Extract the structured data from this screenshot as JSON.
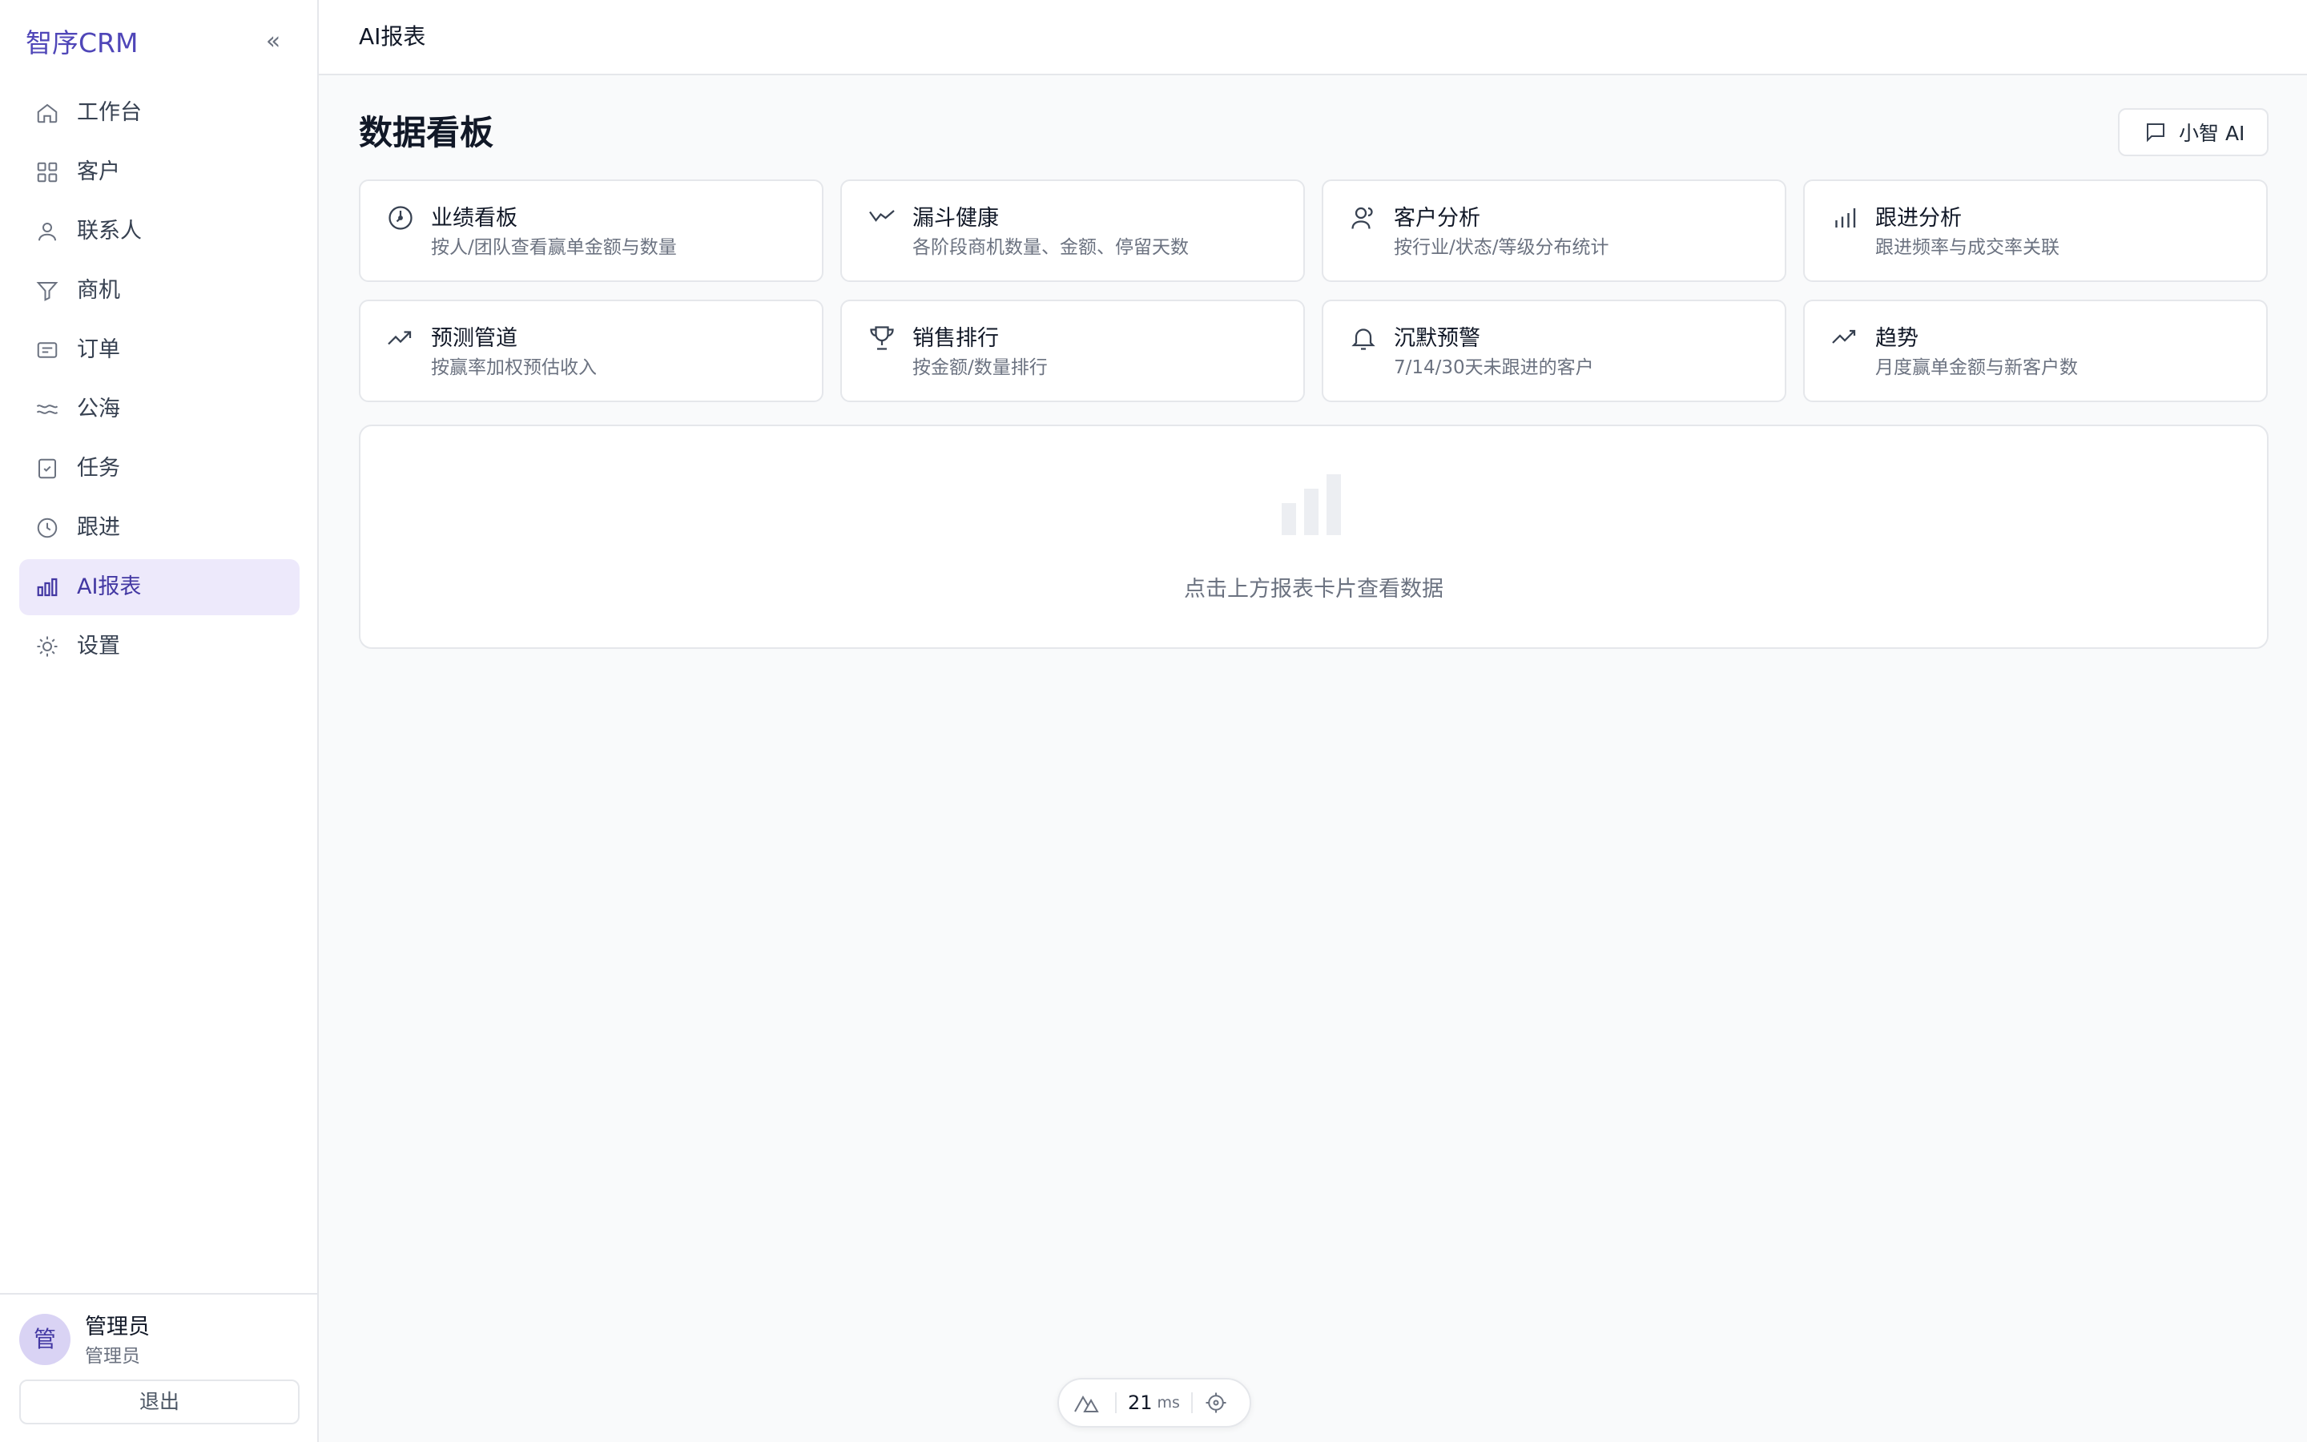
{
  "sidebar": {
    "brand": "智序CRM",
    "collapse_glyph": "«",
    "items": [
      {
        "label": "工作台",
        "icon": "home-icon"
      },
      {
        "label": "客户",
        "icon": "grid-icon"
      },
      {
        "label": "联系人",
        "icon": "user-icon"
      },
      {
        "label": "商机",
        "icon": "funnel-icon"
      },
      {
        "label": "订单",
        "icon": "receipt-icon"
      },
      {
        "label": "公海",
        "icon": "waves-icon"
      },
      {
        "label": "任务",
        "icon": "checkbox-icon"
      },
      {
        "label": "跟进",
        "icon": "clock-icon"
      },
      {
        "label": "AI报表",
        "icon": "bar-chart-icon",
        "active": true
      },
      {
        "label": "设置",
        "icon": "sun-gear-icon"
      }
    ],
    "user": {
      "avatar_char": "管",
      "name": "管理员",
      "role": "管理员"
    },
    "logout_label": "退出"
  },
  "header": {
    "title": "AI报表"
  },
  "main": {
    "page_title": "数据看板",
    "ai_button_label": "小智 AI",
    "cards": [
      {
        "title": "业绩看板",
        "desc": "按人/团队查看赢单金额与数量",
        "icon": "gauge-icon"
      },
      {
        "title": "漏斗健康",
        "desc": "各阶段商机数量、金额、停留天数",
        "icon": "funnel-trend-icon"
      },
      {
        "title": "客户分析",
        "desc": "按行业/状态/等级分布统计",
        "icon": "users-icon"
      },
      {
        "title": "跟进分析",
        "desc": "跟进频率与成交率关联",
        "icon": "bar-chart-icon"
      },
      {
        "title": "预测管道",
        "desc": "按赢率加权预估收入",
        "icon": "trend-up-icon"
      },
      {
        "title": "销售排行",
        "desc": "按金额/数量排行",
        "icon": "trophy-icon"
      },
      {
        "title": "沉默预警",
        "desc": "7/14/30天未跟进的客户",
        "icon": "bell-icon"
      },
      {
        "title": "趋势",
        "desc": "月度赢单金额与新客户数",
        "icon": "trend-line-icon"
      }
    ],
    "empty_text": "点击上方报表卡片查看数据"
  },
  "devtools": {
    "ms_value": "21",
    "ms_unit": "ms"
  },
  "colors": {
    "accent": "#4338a3",
    "active_bg": "#ede9fb",
    "border": "#e5e7eb"
  }
}
